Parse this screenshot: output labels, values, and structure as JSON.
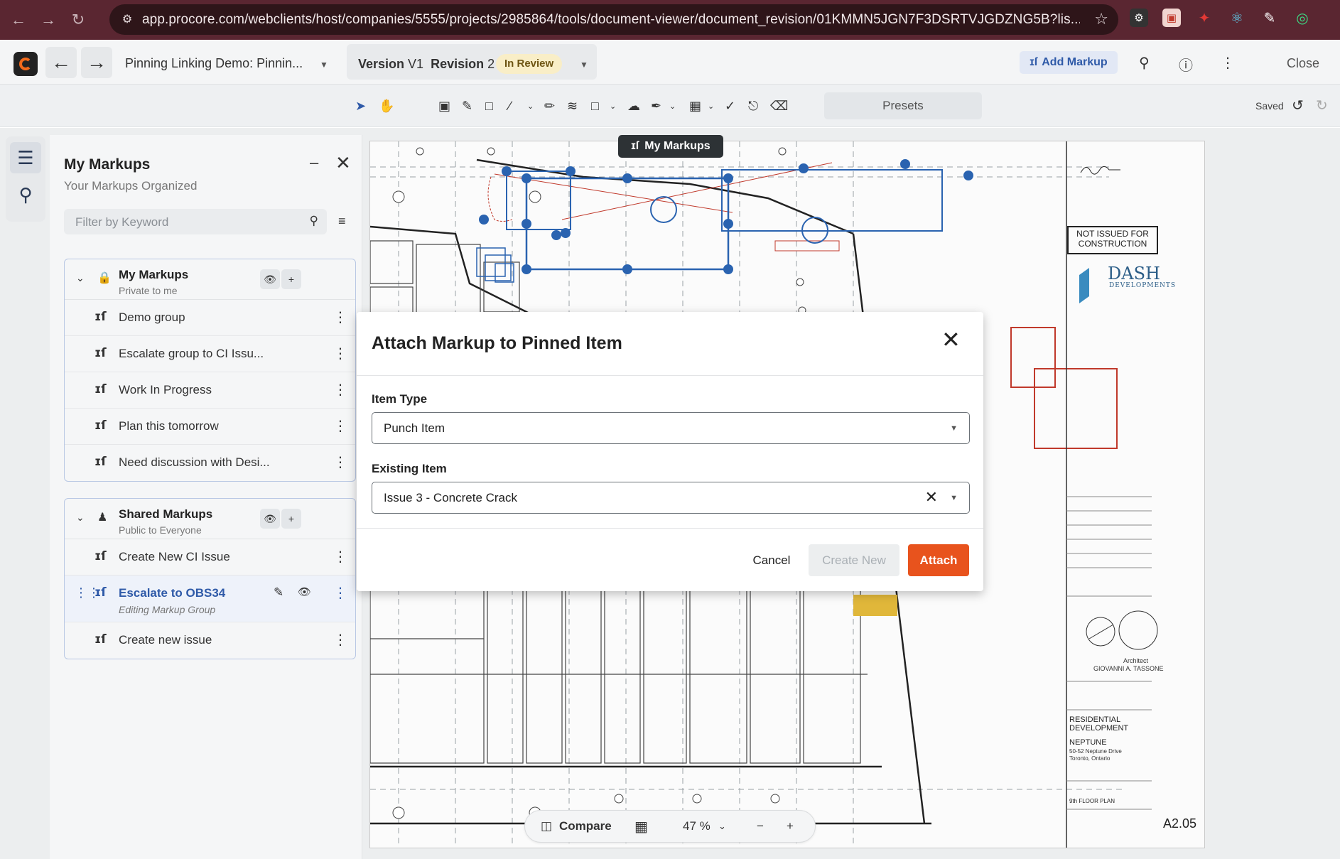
{
  "browser": {
    "url": "app.procore.com/webclients/host/companies/5555/projects/2985864/tools/document-viewer/document_revision/01KMMN5JGN7F3DSRTVJGDZNG5B?lis..."
  },
  "header": {
    "doc_title": "Pinning Linking Demo: Pinnin...",
    "version_label": "Version",
    "version_value": "V1",
    "revision_label": "Revision",
    "revision_value": "2",
    "status": "In Review",
    "add_markup": "Add Markup",
    "close": "Close"
  },
  "toolbar": {
    "presets": "Presets",
    "saved": "Saved"
  },
  "panel": {
    "title": "My Markups",
    "subtitle": "Your Markups Organized",
    "filter_placeholder": "Filter by Keyword",
    "groups": [
      {
        "name": "My Markups",
        "sub": "Private to me",
        "items": [
          "Demo group",
          "Escalate group to CI Issu...",
          "Work In Progress",
          "Plan this tomorrow",
          "Need discussion with Desi..."
        ]
      },
      {
        "name": "Shared Markups",
        "sub": "Public to Everyone",
        "items": [
          "Create New CI Issue",
          "Escalate to OBS34",
          "Create new issue"
        ],
        "selected_sub": "Editing Markup Group"
      }
    ]
  },
  "canvas": {
    "float_tag": "My Markups",
    "title_block": {
      "not_issued": "NOT ISSUED FOR CONSTRUCTION",
      "firm": "DASH",
      "firm_sub": "DEVELOPMENTS",
      "architect_role": "Architect",
      "architect": "GIOVANNI A. TASSONE",
      "project_type": "RESIDENTIAL DEVELOPMENT",
      "project": "NEPTUNE",
      "address": "50-52 Neptune Drive Toronto, Ontario",
      "sheet_title": "9th FLOOR PLAN",
      "sheet_no": "A2.05"
    }
  },
  "bottom_bar": {
    "compare": "Compare",
    "zoom": "47 %"
  },
  "modal": {
    "title": "Attach Markup to Pinned Item",
    "item_type_label": "Item Type",
    "item_type_value": "Punch Item",
    "existing_label": "Existing Item",
    "existing_value": "Issue 3 - Concrete Crack",
    "cancel": "Cancel",
    "create_new": "Create New",
    "attach": "Attach"
  },
  "colors": {
    "browser_bar": "#5a2631",
    "accent": "#e8531d",
    "link": "#2f5aa8",
    "status_pill": "#f9eec7",
    "markup_blue": "#2a63b0",
    "markup_red": "#c0392b"
  }
}
